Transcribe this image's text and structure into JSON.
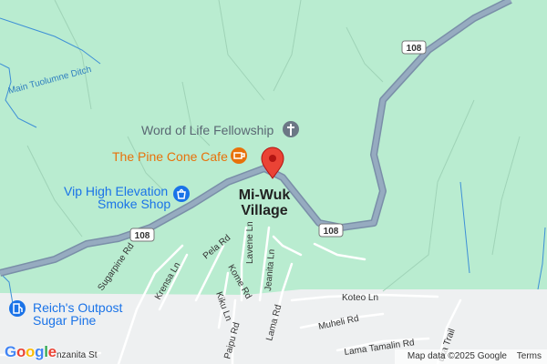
{
  "map": {
    "place": {
      "line1": "Mi-Wuk",
      "line2": "Village"
    },
    "pois": [
      {
        "label": "Word of Life Fellowship",
        "icon": "church-icon",
        "color": "#5a6773"
      },
      {
        "label": "The Pine Cone Cafe",
        "icon": "cafe-icon",
        "color": "#e8710a"
      },
      {
        "label_line1": "Vip High Elevation",
        "label_line2": "Smoke Shop",
        "icon": "shopping-bag-icon",
        "color": "#1a73e8"
      },
      {
        "label_line1": "Reich's Outpost",
        "label_line2": "Sugar Pine",
        "icon": "gas-station-icon",
        "color": "#1a73e8"
      }
    ],
    "highway_shields": [
      "108",
      "108",
      "108"
    ],
    "roads": {
      "sugarpine": "Sugarpine Rd",
      "krensa": "Krensa Ln",
      "pela": "Pela Rd",
      "lavene": "Lavene Ln",
      "jeanita": "Jeanita Ln",
      "kome": "Kome Rd",
      "kiku": "Kiku Ln",
      "paipu": "Paipu Rd",
      "lama": "Lama Rd",
      "koteo": "Koteo Ln",
      "muheli": "Muheli Rd",
      "lama_tamalin": "Lama Tamalin Rd",
      "manzanita": "nzanita St",
      "uka": "uka Trail"
    },
    "water": {
      "ditch": "Main Tuolumne Ditch"
    },
    "colors": {
      "forest": "#b9ecd0",
      "developed": "#eef0f1",
      "highway": "#8aa0b8",
      "road": "#ffffff",
      "water": "#3d8fd6",
      "pin": "#ea4335"
    }
  },
  "attribution": {
    "data": "Map data ©2025 Google",
    "terms": "Terms"
  },
  "logo": "Google"
}
